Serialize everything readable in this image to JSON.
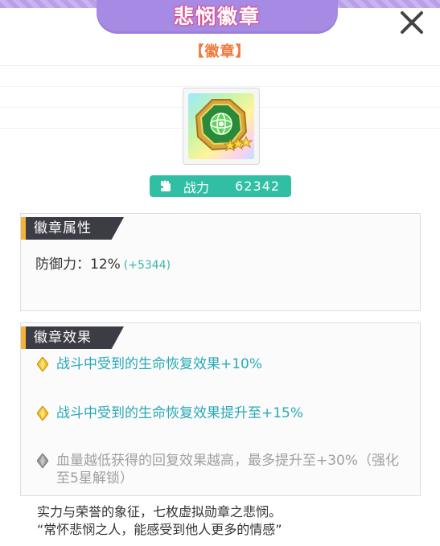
{
  "dialog": {
    "title": "悲悯徽章",
    "subtitle": "【徽章】",
    "close_icon": "close-icon"
  },
  "badge": {
    "icon": "emblem-badge-icon",
    "stars": 3
  },
  "power": {
    "icon": "fist-icon",
    "label": "战力",
    "value": "62342"
  },
  "attributes": {
    "header": "徽章属性",
    "label": "防御力：",
    "value": "12%",
    "bonus": "(+5344)"
  },
  "effects": {
    "header": "徽章效果",
    "items": [
      {
        "text": "战斗中受到的生命恢复效果+10%",
        "state": "active",
        "icon": "gold-gem-icon"
      },
      {
        "text": "战斗中受到的生命恢复效果提升至+15%",
        "state": "active",
        "icon": "gold-gem-icon"
      },
      {
        "text": "血量越低获得的回复效果越高，最多提升至+30%（强化至5星解锁）",
        "state": "locked",
        "icon": "gray-gem-icon"
      }
    ]
  },
  "description": {
    "line1": "实力与荣誉的象征，七枚虚拟勋章之悲悯。",
    "line2": "“常怀悲悯之人，能感受到他人更多的情感”"
  },
  "colors": {
    "title_tab": "#a68ae4",
    "title_outline": "#e1488c",
    "subtitle": "#f2783a",
    "power_pill": "#30bfa4",
    "active_effect": "#29a9b7",
    "locked_effect": "#a0a0a0",
    "panel_header": "#3c3c44",
    "panel_accent": "#f4b23a"
  }
}
